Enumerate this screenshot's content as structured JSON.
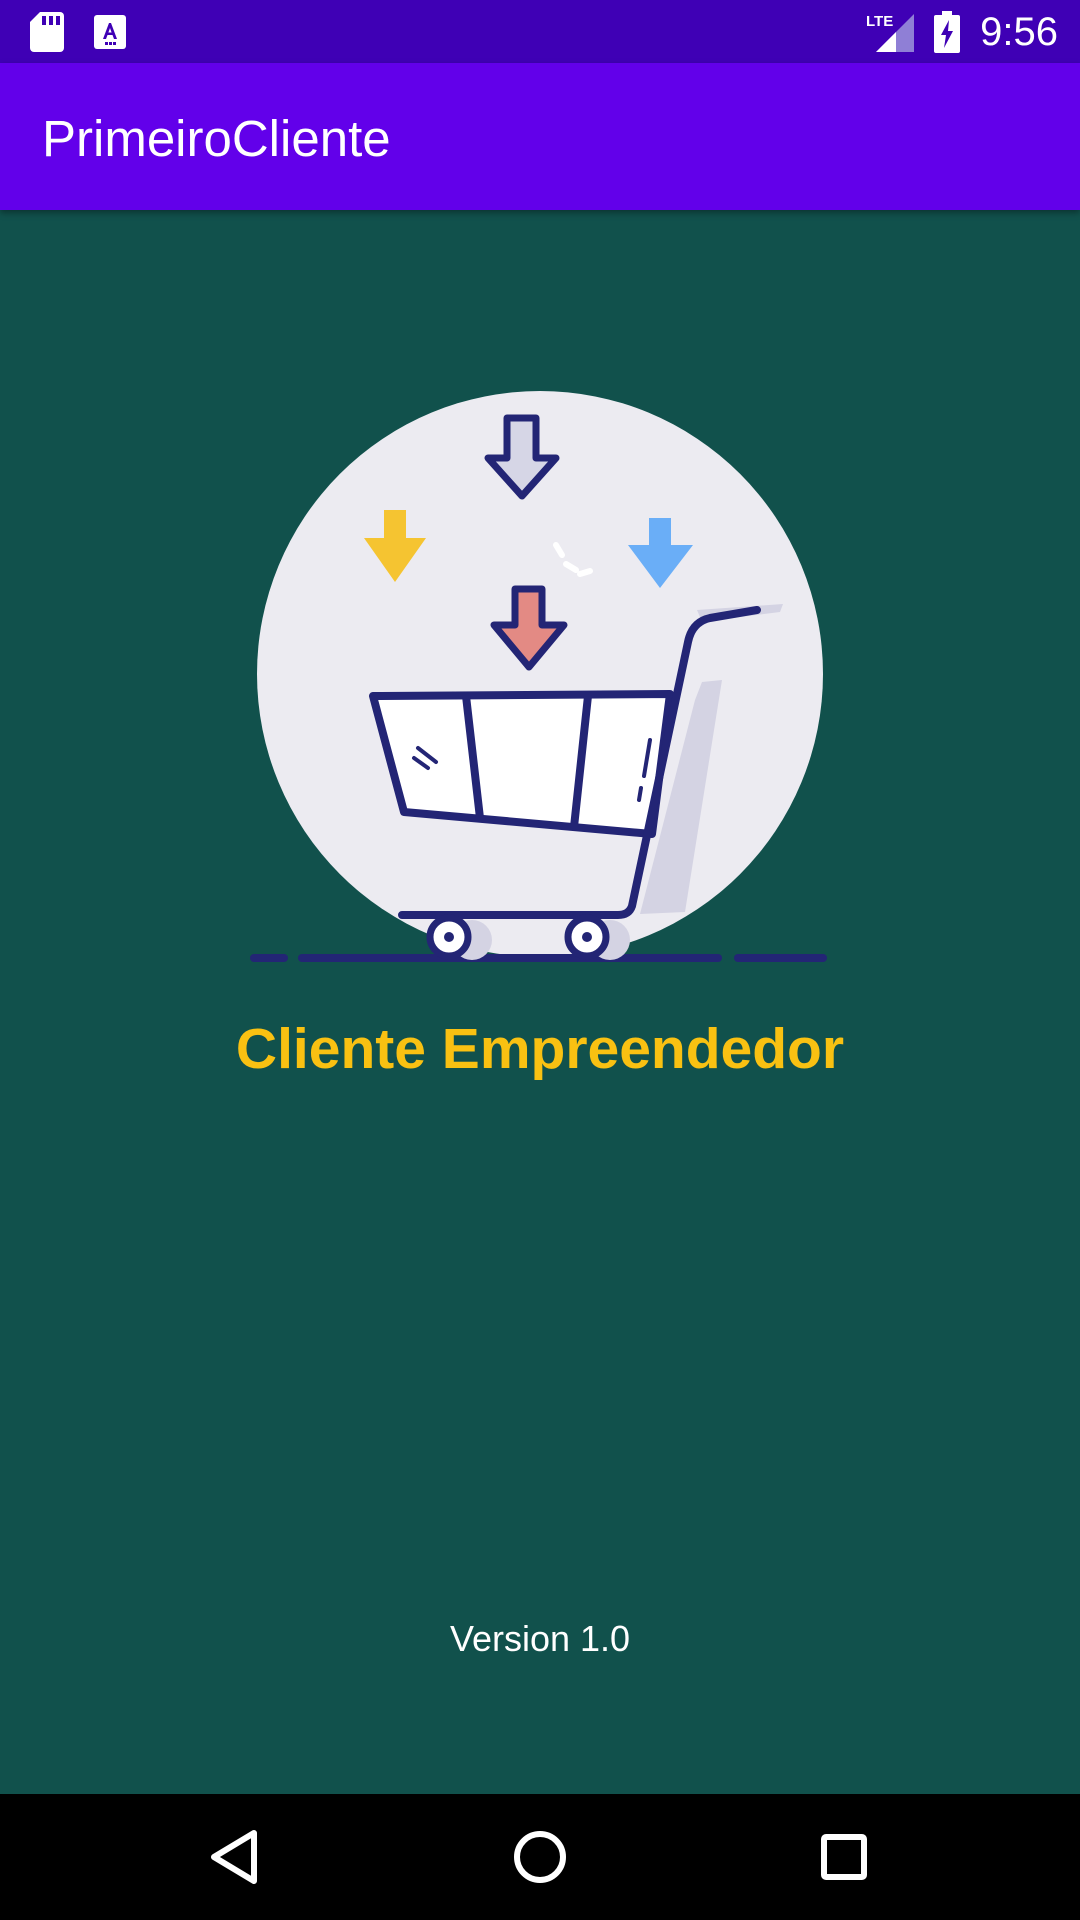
{
  "status_bar": {
    "time": "9:56",
    "network": "LTE",
    "icons": [
      "sd-card-icon",
      "font-download-icon",
      "lte-signal-icon",
      "battery-charging-icon"
    ]
  },
  "app_bar": {
    "title": "PrimeiroCliente"
  },
  "hero": {
    "illustration": "shopping-cart-with-arrows"
  },
  "main": {
    "title": "Cliente Empreendedor",
    "version": "Version 1.0"
  },
  "nav_bar": {
    "buttons": [
      "back-icon",
      "home-icon",
      "recents-icon"
    ]
  },
  "colors": {
    "status_bar": "#3f00b5",
    "app_bar": "#6200ea",
    "background": "#11514c",
    "title_accent": "#f9c112",
    "arrow_yellow": "#f5c431",
    "arrow_blue": "#6aaef7",
    "arrow_red": "#e38a84",
    "arrow_gray": "#d6d6e6",
    "outline": "#232575"
  }
}
